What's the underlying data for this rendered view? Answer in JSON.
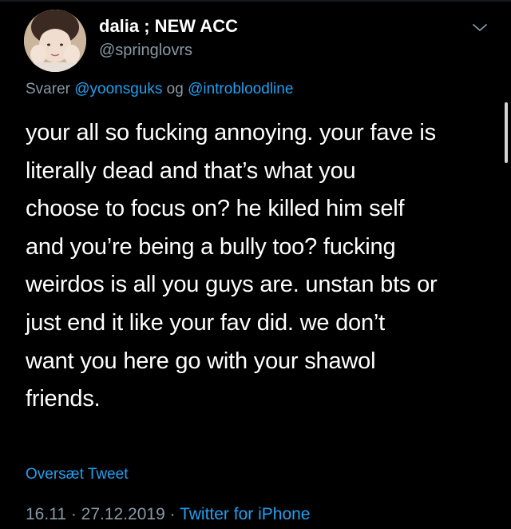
{
  "tweet": {
    "display_name": "dalia ; NEW ACC",
    "handle": "@springlovrs",
    "reply_prefix": "Svarer ",
    "reply_mention_1": "@yoonsguks",
    "reply_joiner": " og ",
    "reply_mention_2": "@introbloodline",
    "text_lines": [
      "your all so fucking annoying. your fave is",
      "literally dead and that’s what you",
      "choose to focus on? he killed him self",
      "and you’re being a bully too? fucking",
      "weirdos is all you guys are. unstan bts or",
      "just end it like your fav did. we don’t",
      "want you here go with your shawol",
      "friends."
    ],
    "translate_label": "Oversæt Tweet",
    "time": "16.11",
    "separator": " · ",
    "date": "27.12.2019",
    "source": "Twitter for iPhone"
  },
  "icons": {
    "avatar": "avatar-photo",
    "menu": "chevron-down-icon"
  },
  "colors": {
    "background": "#000000",
    "text": "#ffffff",
    "secondary": "#8899a6",
    "accent": "#1da1f2"
  }
}
